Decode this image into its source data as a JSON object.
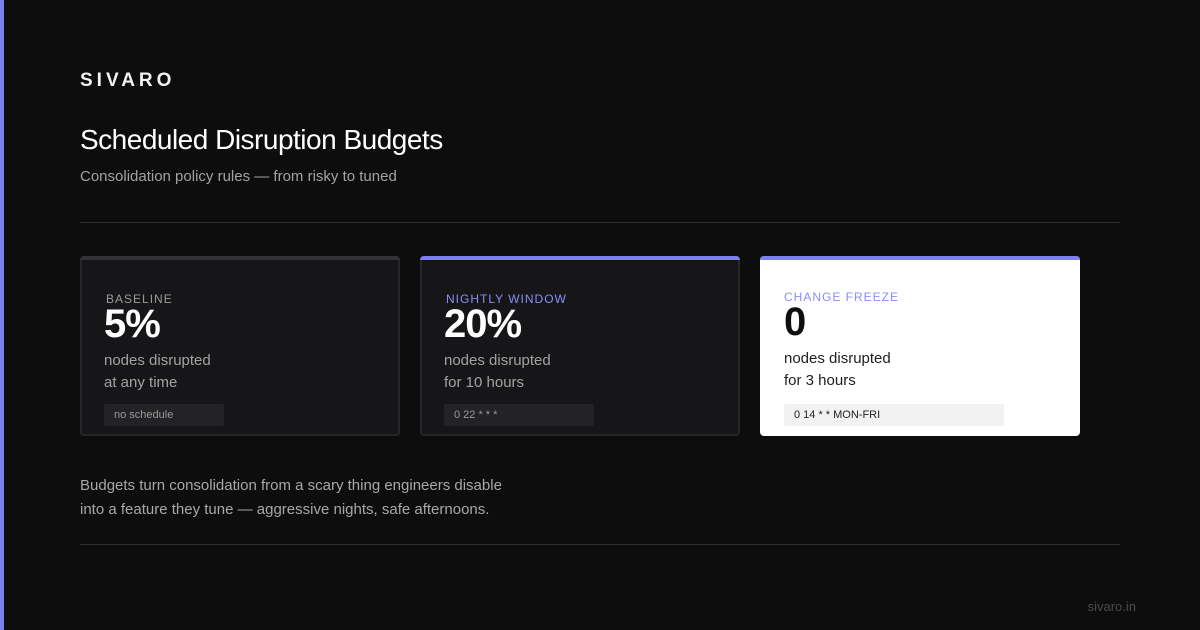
{
  "brand": "SIVARO",
  "title": "Scheduled Disruption Budgets",
  "subtitle": "Consolidation policy rules — from risky to tuned",
  "colors": {
    "accent": "#7c7ff0",
    "background": "#0d0d0d",
    "card_dark": "#161618",
    "card_light": "#ffffff"
  },
  "cards": [
    {
      "label": "BASELINE",
      "value": "5%",
      "desc_line1": "nodes disrupted",
      "desc_line2": "at any time",
      "schedule": "no schedule",
      "theme": "dark",
      "accent_color": "#333336",
      "label_color": "#9a9a9a"
    },
    {
      "label": "NIGHTLY WINDOW",
      "value": "20%",
      "desc_line1": "nodes disrupted",
      "desc_line2": "for 10 hours",
      "schedule": "0 22 * * *",
      "theme": "dark",
      "accent_color": "#7c7ff0",
      "label_color": "#8a8ef5"
    },
    {
      "label": "CHANGE FREEZE",
      "value": "0",
      "desc_line1": "nodes disrupted",
      "desc_line2": "for 3 hours",
      "schedule": "0 14 * * MON-FRI",
      "theme": "light",
      "accent_color": "#7c7ff0",
      "label_color": "#8a8ef5"
    }
  ],
  "body_line1": "Budgets turn consolidation from a scary thing engineers disable",
  "body_line2": "into a feature they tune — aggressive nights, safe afternoons.",
  "footer_url": "sivaro.in"
}
